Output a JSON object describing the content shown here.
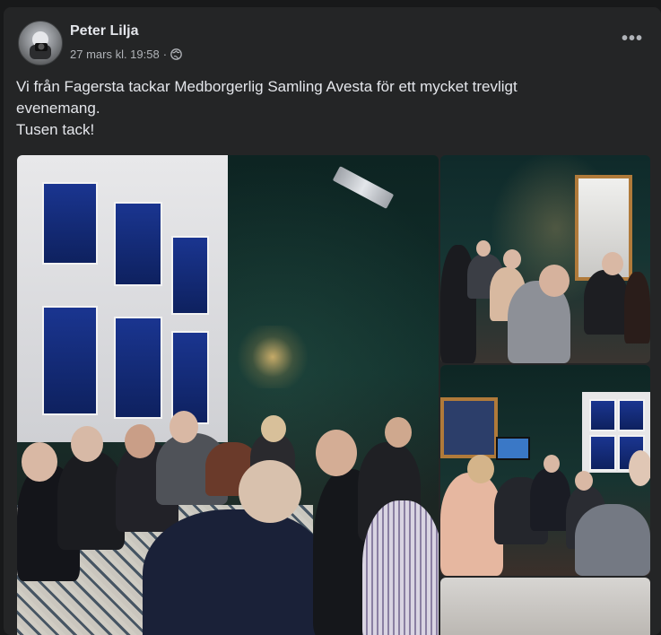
{
  "post": {
    "author": "Peter Lilja",
    "timestamp": "27 mars kl. 19:58",
    "separator": "·",
    "audience_icon": "globe-icon",
    "more_label": "•••",
    "text_lines": [
      "Vi från Fagersta tackar Medborgerlig Samling Avesta för ett mycket trevligt",
      "evenemang.",
      "Tusen tack!"
    ]
  },
  "photos": [
    {
      "name": "photo-main"
    },
    {
      "name": "photo-top-right"
    },
    {
      "name": "photo-middle-right"
    },
    {
      "name": "photo-bottom-right"
    }
  ]
}
